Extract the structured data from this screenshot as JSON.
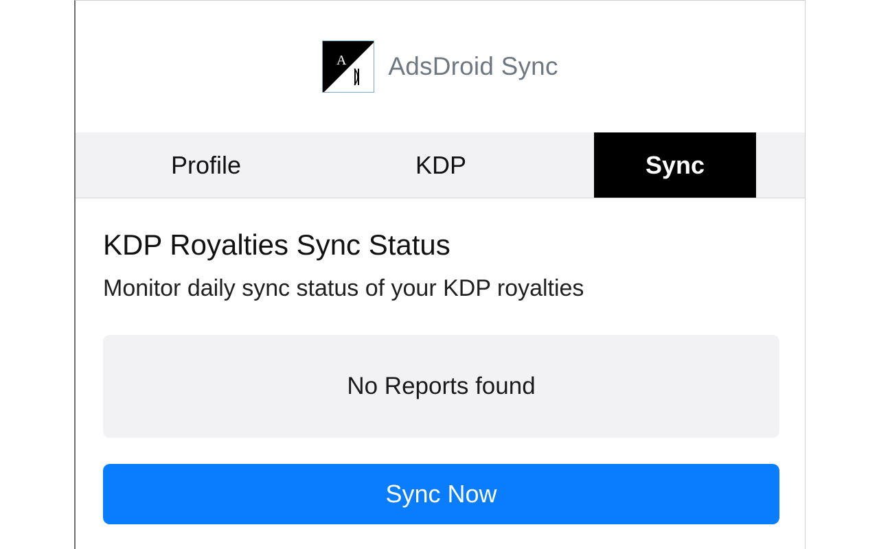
{
  "header": {
    "logo_icon": "adsdroid-logo-icon",
    "logo_letters": "AD",
    "title": "AdsDroid Sync"
  },
  "tabs": [
    {
      "label": "Profile",
      "active": false
    },
    {
      "label": "KDP",
      "active": false
    },
    {
      "label": "Sync",
      "active": true
    }
  ],
  "main": {
    "title": "KDP Royalties Sync Status",
    "subtitle": "Monitor daily sync status of your KDP royalties",
    "empty_message": "No Reports found",
    "sync_button_label": "Sync Now"
  },
  "colors": {
    "accent": "#0a7dff",
    "active_tab_bg": "#000000",
    "panel_bg": "#f2f2f4",
    "title_gray": "#6f7780"
  }
}
